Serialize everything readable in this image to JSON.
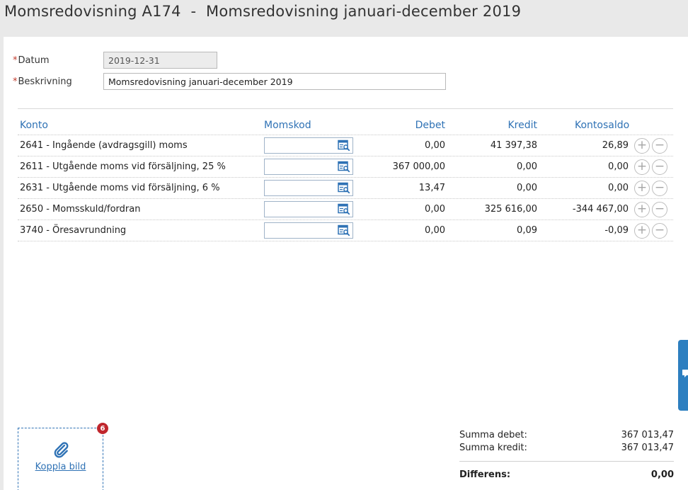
{
  "page": {
    "title": "Momsredovisning A174  -  Momsredovisning januari-december 2019"
  },
  "form": {
    "required_mark": "*",
    "datum_label": "Datum",
    "datum_value": "2019-12-31",
    "beskrivning_label": "Beskrivning",
    "beskrivning_value": "Momsredovisning januari-december 2019"
  },
  "table": {
    "columns": {
      "konto": "Konto",
      "momskod": "Momskod",
      "debet": "Debet",
      "kredit": "Kredit",
      "saldo": "Kontosaldo"
    },
    "rows": [
      {
        "konto": "2641 - Ingående (avdragsgill) moms",
        "momskod": "",
        "debet": "0,00",
        "kredit": "41 397,38",
        "saldo": "26,89"
      },
      {
        "konto": "2611 - Utgående moms vid försäljning, 25 %",
        "momskod": "",
        "debet": "367 000,00",
        "kredit": "0,00",
        "saldo": "0,00"
      },
      {
        "konto": "2631 - Utgående moms vid försäljning, 6 %",
        "momskod": "",
        "debet": "13,47",
        "kredit": "0,00",
        "saldo": "0,00"
      },
      {
        "konto": "2650 - Momsskuld/fordran",
        "momskod": "",
        "debet": "0,00",
        "kredit": "325 616,00",
        "saldo": "-344 467,00"
      },
      {
        "konto": "3740 - Öresavrundning",
        "momskod": "",
        "debet": "0,00",
        "kredit": "0,09",
        "saldo": "-0,09"
      }
    ],
    "add_symbol": "+",
    "remove_symbol": "−"
  },
  "attachment": {
    "badge_count": "6",
    "link_label": "Koppla bild",
    "icon": "paperclip-icon"
  },
  "summary": {
    "summa_debet_label": "Summa debet:",
    "summa_debet_value": "367 013,47",
    "summa_kredit_label": "Summa kredit:",
    "summa_kredit_value": "367 013,47",
    "differens_label": "Differens:",
    "differens_value": "0,00"
  },
  "colors": {
    "accent": "#2f72b5",
    "required": "#c0392b",
    "badge": "#c0262d",
    "chat_tab": "#2d7fc0"
  }
}
